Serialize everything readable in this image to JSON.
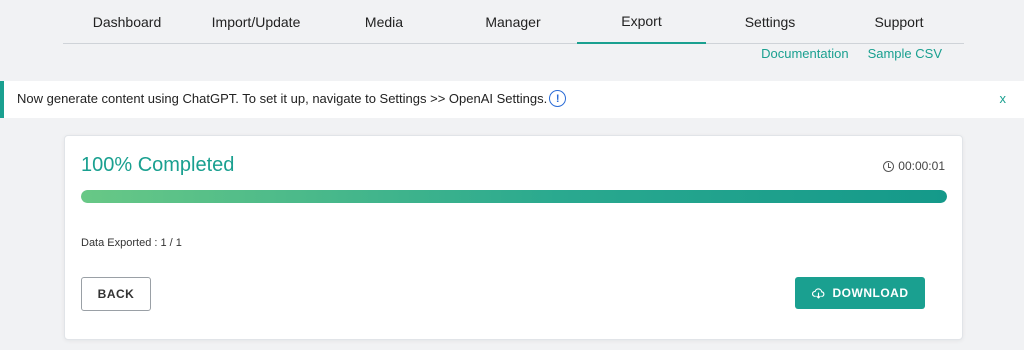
{
  "nav": {
    "tabs": [
      {
        "label": "Dashboard",
        "active": false
      },
      {
        "label": "Import/Update",
        "active": false
      },
      {
        "label": "Media",
        "active": false
      },
      {
        "label": "Manager",
        "active": false
      },
      {
        "label": "Export",
        "active": true
      },
      {
        "label": "Settings",
        "active": false
      },
      {
        "label": "Support",
        "active": false
      }
    ],
    "links": {
      "documentation": "Documentation",
      "sample_csv": "Sample CSV"
    }
  },
  "notice": {
    "text": "Now generate content using ChatGPT. To set it up, navigate to Settings >> OpenAI Settings.",
    "info_glyph": "!",
    "close_label": "x"
  },
  "export": {
    "title": "100% Completed",
    "elapsed": "00:00:01",
    "progress_fraction": 1.0,
    "exported_text": "Data Exported : 1 / 1",
    "back_label": "BACK",
    "download_label": "DOWNLOAD"
  },
  "colors": {
    "accent": "#1aa090",
    "progress_start": "#68c886",
    "progress_end": "#14998a",
    "info_icon": "#2b6cd6"
  },
  "icons": {
    "info": "info-circle-icon",
    "clock": "clock-icon",
    "download": "cloud-download-icon"
  }
}
